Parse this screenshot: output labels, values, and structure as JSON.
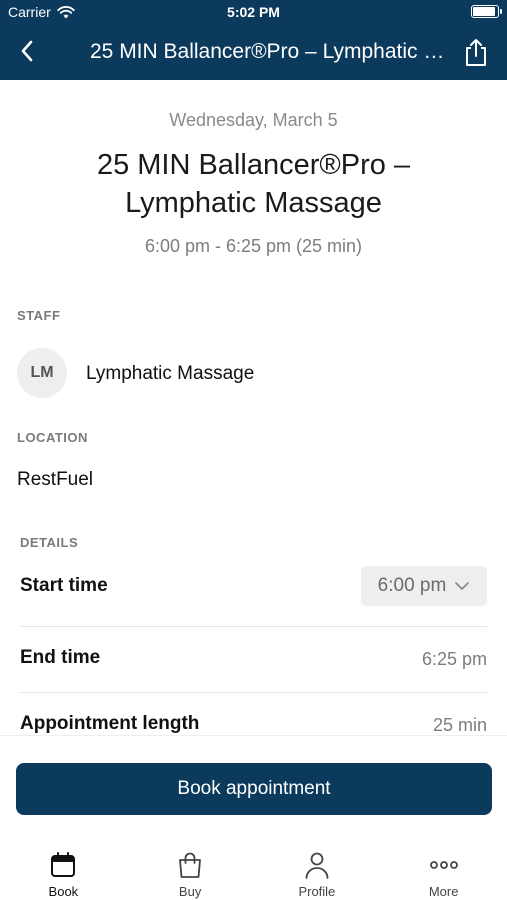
{
  "status_bar": {
    "carrier": "Carrier",
    "time": "5:02 PM",
    "icons": [
      "wifi-icon",
      "battery-icon"
    ]
  },
  "nav": {
    "title": "25 MIN Ballancer®Pro – Lymphatic Massage",
    "back_icon": "chevron-left-icon",
    "share_icon": "share-icon"
  },
  "appointment": {
    "date": "Wednesday, March 5",
    "title": "25 MIN Ballancer®Pro – Lymphatic Massage",
    "time_range": "6:00 pm - 6:25 pm (25 min)"
  },
  "staff": {
    "label": "STAFF",
    "initials": "LM",
    "name": "Lymphatic Massage"
  },
  "location": {
    "label": "LOCATION",
    "name": "RestFuel"
  },
  "details": {
    "label": "DETAILS",
    "start_time_label": "Start time",
    "start_time_value": "6:00 pm",
    "end_time_label": "End time",
    "end_time_value": "6:25 pm",
    "length_label": "Appointment length",
    "length_value": "25 min"
  },
  "book_button": {
    "label": "Book appointment"
  },
  "tabs": [
    {
      "label": "Book",
      "icon": "calendar-icon",
      "active": true
    },
    {
      "label": "Buy",
      "icon": "shopping-bag-icon",
      "active": false
    },
    {
      "label": "Profile",
      "icon": "person-icon",
      "active": false
    },
    {
      "label": "More",
      "icon": "more-dots-icon",
      "active": false
    }
  ],
  "colors": {
    "brand": "#0b3a5c",
    "muted_text": "#7d7d7d",
    "active_tab": "#111111",
    "inactive_tab": "#444444"
  }
}
